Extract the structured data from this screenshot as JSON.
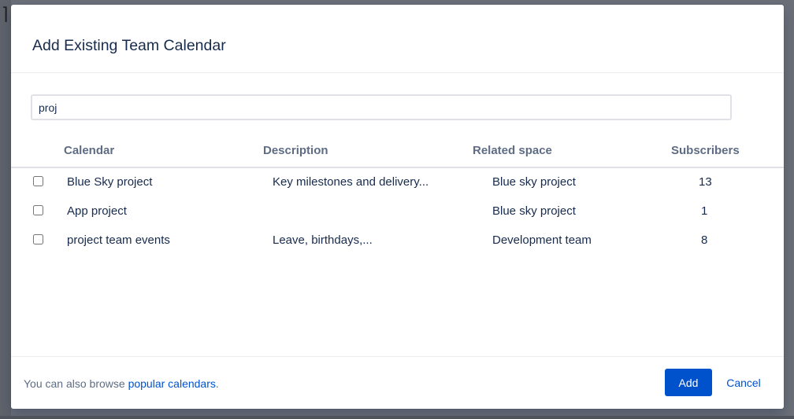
{
  "dialog": {
    "title": "Add Existing Team Calendar",
    "search": {
      "value": "proj",
      "placeholder": ""
    },
    "table": {
      "columns": [
        "Calendar",
        "Description",
        "Related space",
        "Subscribers"
      ],
      "rows": [
        {
          "checked": false,
          "calendar": "Blue Sky project",
          "description": "Key milestones and delivery...",
          "space": "Blue sky project",
          "subscribers": "13"
        },
        {
          "checked": false,
          "calendar": "App project",
          "description": "",
          "space": "Blue sky project",
          "subscribers": "1"
        },
        {
          "checked": false,
          "calendar": "project team events",
          "description": "Leave, birthdays,...",
          "space": "Development team",
          "subscribers": "8"
        }
      ]
    },
    "footer": {
      "prefix": "You can also browse ",
      "link": "popular calendars",
      "suffix": ".",
      "add_label": "Add",
      "cancel_label": "Cancel"
    }
  },
  "colors": {
    "primary": "#0052cc",
    "text": "#172b4d",
    "subtle_text": "#5e6c84",
    "backdrop": "#6b6f78"
  }
}
